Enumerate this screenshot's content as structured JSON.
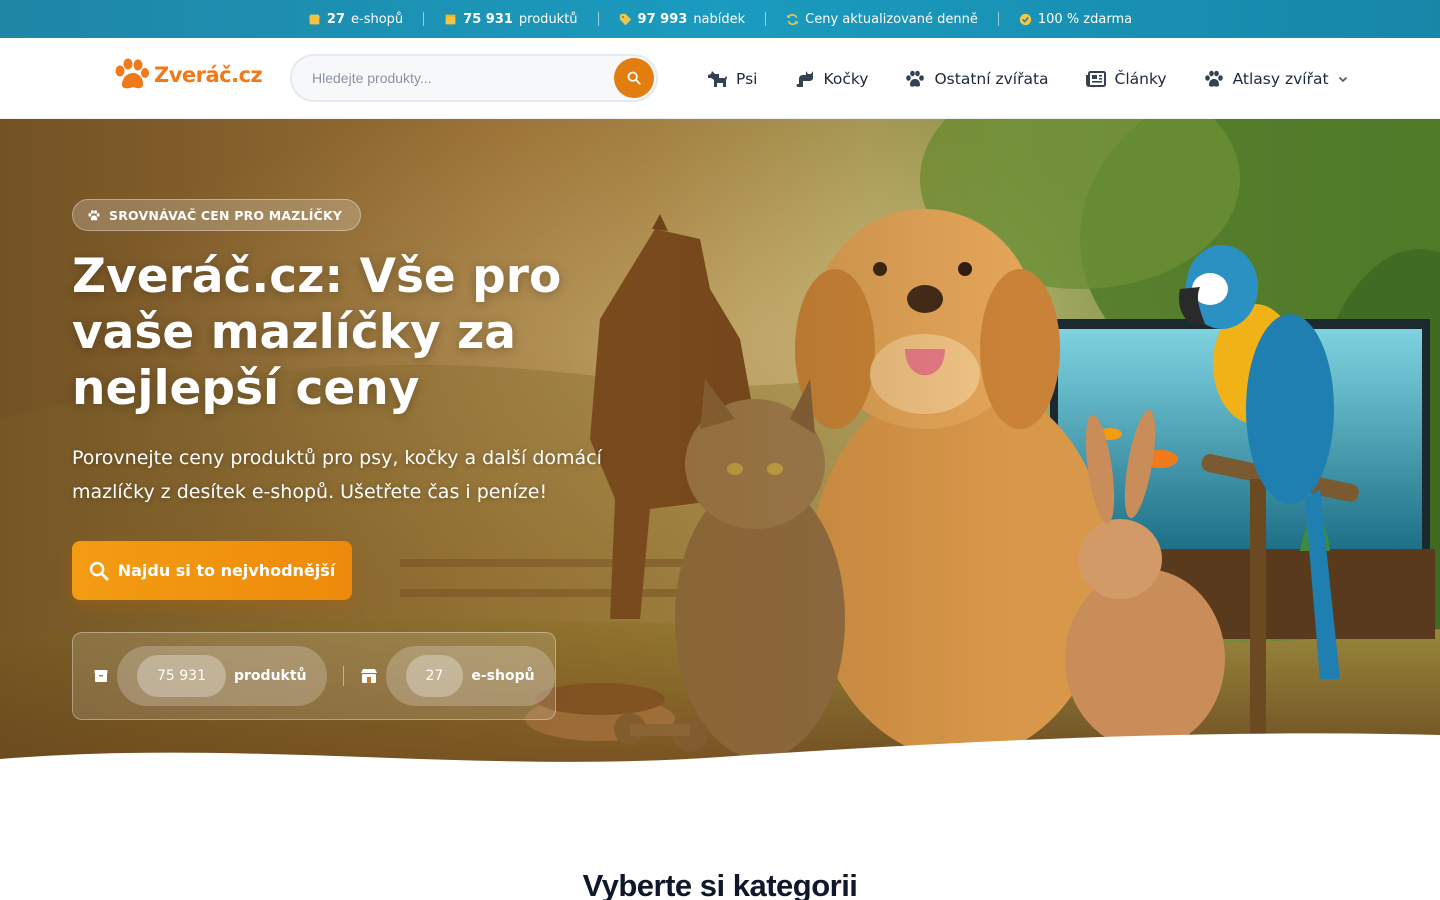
{
  "topbar": {
    "items": [
      {
        "value": "27",
        "label": "e-shopů",
        "icon": "shop-icon"
      },
      {
        "value": "75 931",
        "label": "produktů",
        "icon": "box-icon"
      },
      {
        "value": "97 993",
        "label": "nabídek",
        "icon": "tag-icon"
      },
      {
        "value": "",
        "label": "Ceny aktualizované denně",
        "icon": "refresh-icon"
      },
      {
        "value": "",
        "label": "100 % zdarma",
        "icon": "check-circle-icon"
      }
    ]
  },
  "header": {
    "logo_text": "Zveráč.cz",
    "search": {
      "placeholder": "Hledejte produkty...",
      "value": ""
    },
    "nav": [
      {
        "label": "Psi",
        "icon": "dog-icon"
      },
      {
        "label": "Kočky",
        "icon": "cat-icon"
      },
      {
        "label": "Ostatní zvířata",
        "icon": "paw-icon"
      },
      {
        "label": "Články",
        "icon": "newspaper-icon"
      },
      {
        "label": "Atlasy zvířat",
        "icon": "paw-icon"
      }
    ]
  },
  "hero": {
    "badge": "SROVNÁVAČ CEN PRO MAZLÍČKY",
    "title": "Zveráč.cz: Vše pro vaše mazlíčky za nejlepší ceny",
    "subtitle": "Porovnejte ceny produktů pro psy, kočky a další domácí mazlíčky z desítek e-shopů. Ušetřete čas i peníze!",
    "cta": "Najdu si to nejvhodnější",
    "stats": [
      {
        "value": "75 931",
        "label": "produktů",
        "icon": "box-icon"
      },
      {
        "value": "27",
        "label": "e-shopů",
        "icon": "store-icon"
      }
    ]
  },
  "section": {
    "title": "Vyberte si kategorii"
  },
  "colors": {
    "accent": "#ee8a0b",
    "topbar": "#1a9bbf",
    "text": "#1e293b"
  }
}
